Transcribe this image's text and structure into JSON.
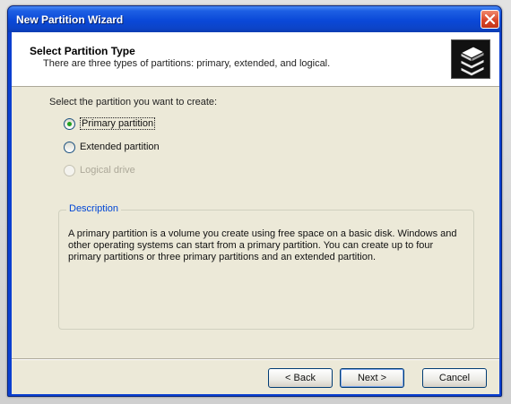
{
  "window": {
    "title": "New Partition Wizard"
  },
  "header": {
    "title": "Select Partition Type",
    "subtitle": "There are three types of partitions: primary, extended, and logical."
  },
  "main": {
    "prompt": "Select the partition you want to create:",
    "options": [
      {
        "label": "Primary partition",
        "checked": true,
        "enabled": true
      },
      {
        "label": "Extended partition",
        "checked": false,
        "enabled": true
      },
      {
        "label": "Logical drive",
        "checked": false,
        "enabled": false
      }
    ],
    "description_title": "Description",
    "description_text": "A primary partition is a volume you create using free space on a basic disk. Windows and other operating systems can start from a primary partition. You can create up to four primary partitions or three primary partitions and an extended partition."
  },
  "buttons": {
    "back": "< Back",
    "next": "Next >",
    "cancel": "Cancel"
  },
  "icons": {
    "close": "close-icon",
    "wizard": "disk-stack-icon"
  },
  "colors": {
    "titlebar": "#0a48d8",
    "close_button": "#d9462a",
    "dialog_bg": "#ece9d8",
    "group_title": "#0046d5"
  }
}
